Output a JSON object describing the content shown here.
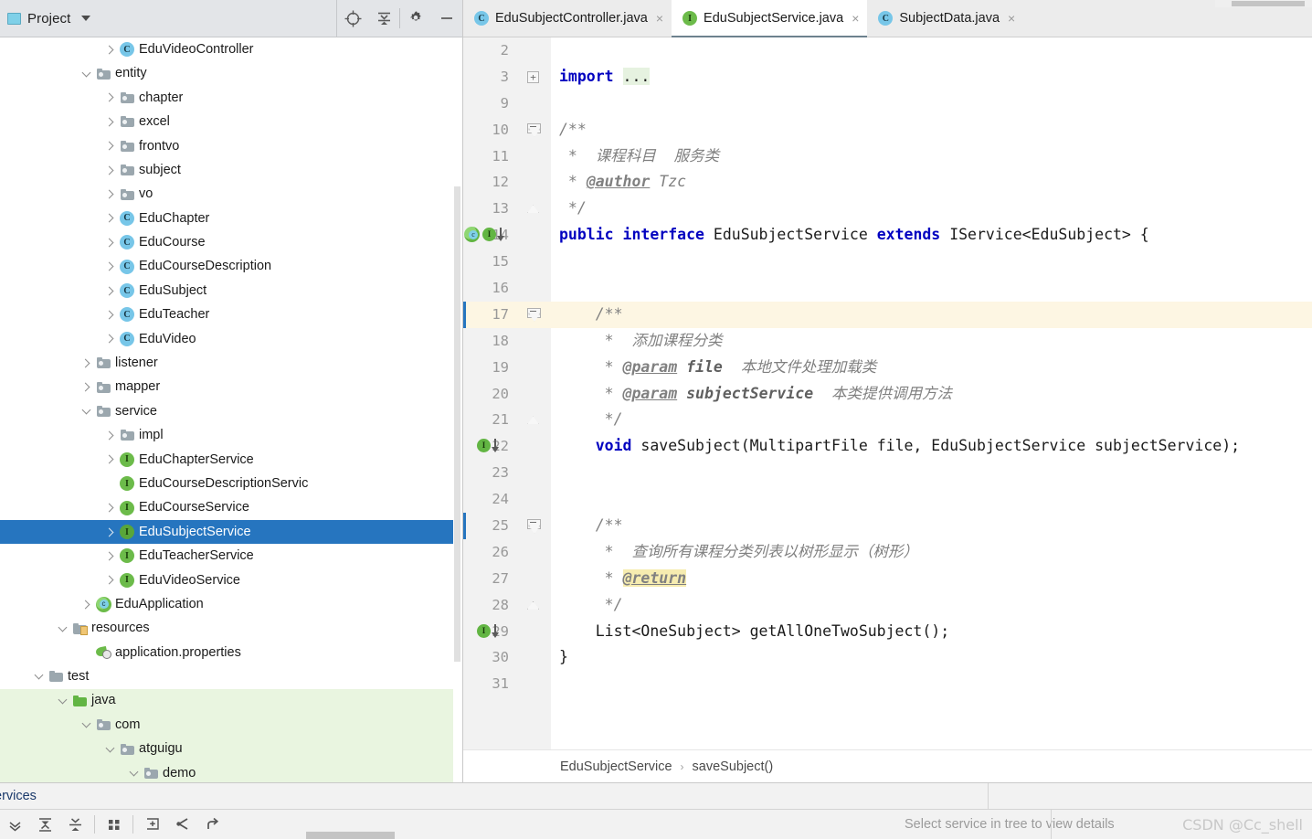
{
  "panel": {
    "title": "Project",
    "tools": [
      {
        "name": "locate-icon",
        "glyph": "locate"
      },
      {
        "name": "collapse-all-icon",
        "glyph": "collapse"
      },
      {
        "name": "settings-gear-icon",
        "glyph": "gear"
      },
      {
        "name": "hide-panel-icon",
        "glyph": "minus"
      }
    ],
    "tree": [
      {
        "label": "EduVideoController",
        "indent": 4,
        "arrow": "right",
        "icon": "class",
        "state": "normal"
      },
      {
        "label": "entity",
        "indent": 3,
        "arrow": "down",
        "icon": "folder",
        "state": "normal"
      },
      {
        "label": "chapter",
        "indent": 4,
        "arrow": "right",
        "icon": "folder",
        "state": "normal"
      },
      {
        "label": "excel",
        "indent": 4,
        "arrow": "right",
        "icon": "folder",
        "state": "normal"
      },
      {
        "label": "frontvo",
        "indent": 4,
        "arrow": "right",
        "icon": "folder",
        "state": "normal"
      },
      {
        "label": "subject",
        "indent": 4,
        "arrow": "right",
        "icon": "folder",
        "state": "normal"
      },
      {
        "label": "vo",
        "indent": 4,
        "arrow": "right",
        "icon": "folder",
        "state": "normal"
      },
      {
        "label": "EduChapter",
        "indent": 4,
        "arrow": "right",
        "icon": "class",
        "state": "normal"
      },
      {
        "label": "EduCourse",
        "indent": 4,
        "arrow": "right",
        "icon": "class",
        "state": "normal"
      },
      {
        "label": "EduCourseDescription",
        "indent": 4,
        "arrow": "right",
        "icon": "class",
        "state": "normal"
      },
      {
        "label": "EduSubject",
        "indent": 4,
        "arrow": "right",
        "icon": "class",
        "state": "normal"
      },
      {
        "label": "EduTeacher",
        "indent": 4,
        "arrow": "right",
        "icon": "class",
        "state": "normal"
      },
      {
        "label": "EduVideo",
        "indent": 4,
        "arrow": "right",
        "icon": "class",
        "state": "normal"
      },
      {
        "label": "listener",
        "indent": 3,
        "arrow": "right",
        "icon": "folder",
        "state": "normal"
      },
      {
        "label": "mapper",
        "indent": 3,
        "arrow": "right",
        "icon": "folder",
        "state": "normal"
      },
      {
        "label": "service",
        "indent": 3,
        "arrow": "down",
        "icon": "folder",
        "state": "normal"
      },
      {
        "label": "impl",
        "indent": 4,
        "arrow": "right",
        "icon": "folder",
        "state": "normal"
      },
      {
        "label": "EduChapterService",
        "indent": 4,
        "arrow": "right",
        "icon": "interface",
        "state": "normal"
      },
      {
        "label": "EduCourseDescriptionServic",
        "indent": 4,
        "arrow": "none",
        "icon": "interface",
        "state": "normal"
      },
      {
        "label": "EduCourseService",
        "indent": 4,
        "arrow": "right",
        "icon": "interface",
        "state": "normal"
      },
      {
        "label": "EduSubjectService",
        "indent": 4,
        "arrow": "right",
        "icon": "interface",
        "state": "selected"
      },
      {
        "label": "EduTeacherService",
        "indent": 4,
        "arrow": "right",
        "icon": "interface",
        "state": "normal"
      },
      {
        "label": "EduVideoService",
        "indent": 4,
        "arrow": "right",
        "icon": "interface",
        "state": "normal"
      },
      {
        "label": "EduApplication",
        "indent": 3,
        "arrow": "right",
        "icon": "springboot",
        "state": "normal"
      },
      {
        "label": "resources",
        "indent": 2,
        "arrow": "down",
        "icon": "resources",
        "state": "normal"
      },
      {
        "label": "application.properties",
        "indent": 3,
        "arrow": "none",
        "icon": "properties",
        "state": "normal"
      },
      {
        "label": "test",
        "indent": 1,
        "arrow": "down",
        "icon": "folder-plain",
        "state": "normal"
      },
      {
        "label": "java",
        "indent": 2,
        "arrow": "down",
        "icon": "folder-green",
        "state": "green"
      },
      {
        "label": "com",
        "indent": 3,
        "arrow": "down",
        "icon": "folder",
        "state": "green"
      },
      {
        "label": "atguigu",
        "indent": 4,
        "arrow": "down",
        "icon": "folder",
        "state": "green"
      },
      {
        "label": "demo",
        "indent": 5,
        "arrow": "down",
        "icon": "folder",
        "state": "green"
      }
    ]
  },
  "tabs": [
    {
      "label": "EduSubjectController.java",
      "icon": "class",
      "active": false,
      "close": "×"
    },
    {
      "label": "EduSubjectService.java",
      "icon": "interface",
      "active": true,
      "close": "×"
    },
    {
      "label": "SubjectData.java",
      "icon": "class",
      "active": false,
      "close": "×"
    }
  ],
  "code": {
    "lines": [
      {
        "num": "2",
        "segments": []
      },
      {
        "num": "3",
        "fold": "collapsed",
        "segments": [
          {
            "t": "import ",
            "c": "kw"
          },
          {
            "t": "...",
            "c": "plain hl-green"
          }
        ]
      },
      {
        "num": "9",
        "segments": []
      },
      {
        "num": "10",
        "fold": "start",
        "segments": [
          {
            "t": "/**",
            "c": "cmt"
          }
        ]
      },
      {
        "num": "11",
        "segments": [
          {
            "t": " *  课程科目  服务类",
            "c": "cmt"
          }
        ]
      },
      {
        "num": "12",
        "segments": [
          {
            "t": " * ",
            "c": "cmt"
          },
          {
            "t": "@author",
            "c": "tagk"
          },
          {
            "t": " Tzc",
            "c": "cmt"
          }
        ]
      },
      {
        "num": "13",
        "fold": "end",
        "segments": [
          {
            "t": " */",
            "c": "cmt"
          }
        ]
      },
      {
        "num": "14",
        "gutter": "class-interface-override",
        "segments": [
          {
            "t": "public ",
            "c": "kw"
          },
          {
            "t": "interface ",
            "c": "kw"
          },
          {
            "t": "EduSubjectService ",
            "c": "plain"
          },
          {
            "t": "extends ",
            "c": "kw"
          },
          {
            "t": "IService<EduSubject> {",
            "c": "plain"
          }
        ]
      },
      {
        "num": "15",
        "segments": []
      },
      {
        "num": "16",
        "segments": []
      },
      {
        "num": "17",
        "fold": "start",
        "highlight": true,
        "caret": true,
        "segments": [
          {
            "t": "    /**",
            "c": "cmt"
          }
        ]
      },
      {
        "num": "18",
        "segments": [
          {
            "t": "     *  添加课程分类",
            "c": "cmt"
          }
        ]
      },
      {
        "num": "19",
        "segments": [
          {
            "t": "     * ",
            "c": "cmt"
          },
          {
            "t": "@param",
            "c": "tagk"
          },
          {
            "t": " ",
            "c": "cmt"
          },
          {
            "t": "file",
            "c": "cmt-b"
          },
          {
            "t": "  本地文件处理加载类",
            "c": "cmt"
          }
        ]
      },
      {
        "num": "20",
        "segments": [
          {
            "t": "     * ",
            "c": "cmt"
          },
          {
            "t": "@param",
            "c": "tagk"
          },
          {
            "t": " ",
            "c": "cmt"
          },
          {
            "t": "subjectService",
            "c": "cmt-b"
          },
          {
            "t": "  本类提供调用方法",
            "c": "cmt"
          }
        ]
      },
      {
        "num": "21",
        "fold": "end",
        "segments": [
          {
            "t": "     */",
            "c": "cmt"
          }
        ]
      },
      {
        "num": "22",
        "gutter": "interface-override",
        "segments": [
          {
            "t": "    ",
            "c": "plain"
          },
          {
            "t": "void ",
            "c": "kw"
          },
          {
            "t": "saveSubject(MultipartFile file, EduSubjectService subjectService);",
            "c": "plain"
          }
        ]
      },
      {
        "num": "23",
        "segments": []
      },
      {
        "num": "24",
        "segments": []
      },
      {
        "num": "25",
        "fold": "start",
        "caret2": true,
        "segments": [
          {
            "t": "    /**",
            "c": "cmt"
          }
        ]
      },
      {
        "num": "26",
        "segments": [
          {
            "t": "     *  查询所有课程分类列表以树形显示（树形）",
            "c": "cmt"
          }
        ]
      },
      {
        "num": "27",
        "segments": [
          {
            "t": "     * ",
            "c": "cmt"
          },
          {
            "t": "@return",
            "c": "tagk hl-yellow"
          }
        ]
      },
      {
        "num": "28",
        "fold": "end",
        "segments": [
          {
            "t": "     */",
            "c": "cmt"
          }
        ]
      },
      {
        "num": "29",
        "gutter": "interface-override",
        "segments": [
          {
            "t": "    List<OneSubject> getAllOneTwoSubject();",
            "c": "plain"
          }
        ]
      },
      {
        "num": "30",
        "segments": [
          {
            "t": "}",
            "c": "plain"
          }
        ]
      },
      {
        "num": "31",
        "segments": []
      }
    ]
  },
  "breadcrumb": {
    "items": [
      "EduSubjectService",
      "saveSubject()"
    ],
    "separator": "›"
  },
  "bottom": {
    "services_label": "ervices",
    "service_hint": "Select service in tree to view details",
    "watermark": "CSDN @Cc_shell",
    "toolbar": [
      {
        "name": "expand-all-icon"
      },
      {
        "name": "collapse-all-icon"
      },
      {
        "name": "group-icon"
      },
      {
        "name": "add-service-icon"
      },
      {
        "name": "filter-icon"
      },
      {
        "name": "branch-icon"
      }
    ]
  },
  "colors": {
    "selection_blue": "#2675bf",
    "keyword_blue": "#0000c0",
    "comment_gray": "#808080",
    "highlight_yellow": "#f6ecb0",
    "green_module": "#e9f5e0",
    "interface_green": "#62b543",
    "class_blue": "#77c6e8"
  }
}
